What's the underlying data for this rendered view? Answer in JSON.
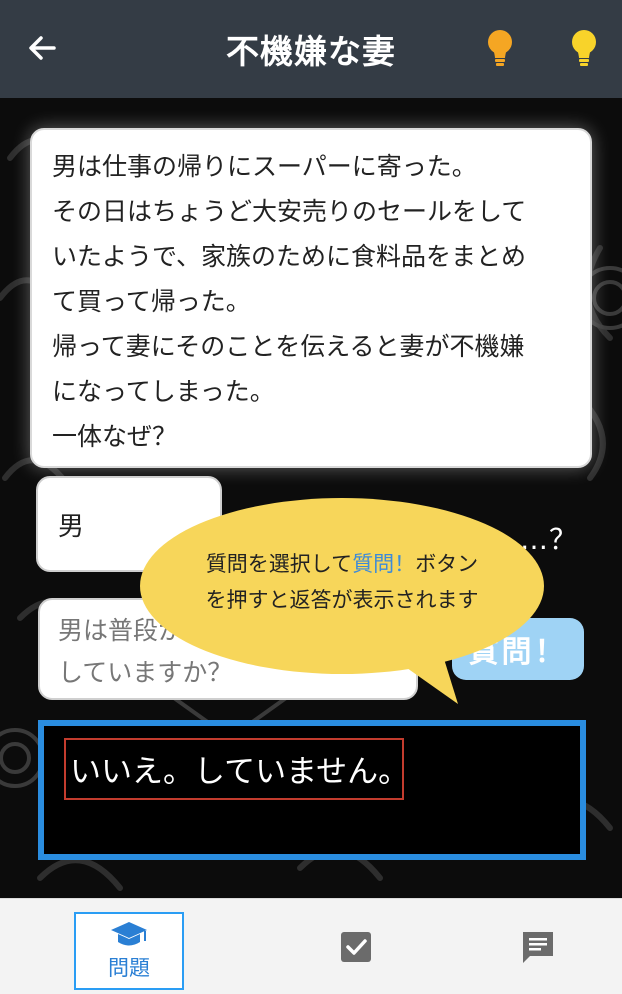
{
  "header": {
    "title": "不機嫌な妻",
    "back_icon": "arrow-left-icon",
    "hint_icon_1": "lightbulb-icon",
    "hint_icon_2": "lightbulb-icon"
  },
  "story": {
    "lines": [
      "男は仕事の帰りにスーパーに寄った。",
      "その日はちょうど大安売りのセールをして",
      "いたようで、家族のために食料品をまとめ",
      "て買って帰った。",
      "帰って妻にそのことを伝えると妻が不機嫌",
      "になってしまった。",
      "一体なぜ？"
    ]
  },
  "subject": {
    "value": "男",
    "suffix": "…？"
  },
  "question": {
    "selected_lines": [
      "男は普段から買い物を",
      "していますか？"
    ]
  },
  "ask_button": {
    "label": "質問！"
  },
  "answer": {
    "text": "いいえ。していません。"
  },
  "tooltip": {
    "line1_part1": "質問を選択して",
    "line1_part2": "質問！",
    "line1_part3": "ボタン",
    "line2": "を押すと返答が表示されます"
  },
  "bottom_nav": {
    "problems_label": "問題",
    "problems_icon": "graduation-cap-icon",
    "check_icon": "checkbox-icon",
    "chat_icon": "chat-icon"
  },
  "colors": {
    "header_bg": "#343c45",
    "accent_blue": "#2a8de0",
    "ask_button_bg": "#9fd3f5",
    "tooltip_bg": "#f7d65a",
    "highlight_red": "#c33c2e",
    "bulb_orange": "#f5a623",
    "bulb_yellow": "#f8d32a"
  }
}
